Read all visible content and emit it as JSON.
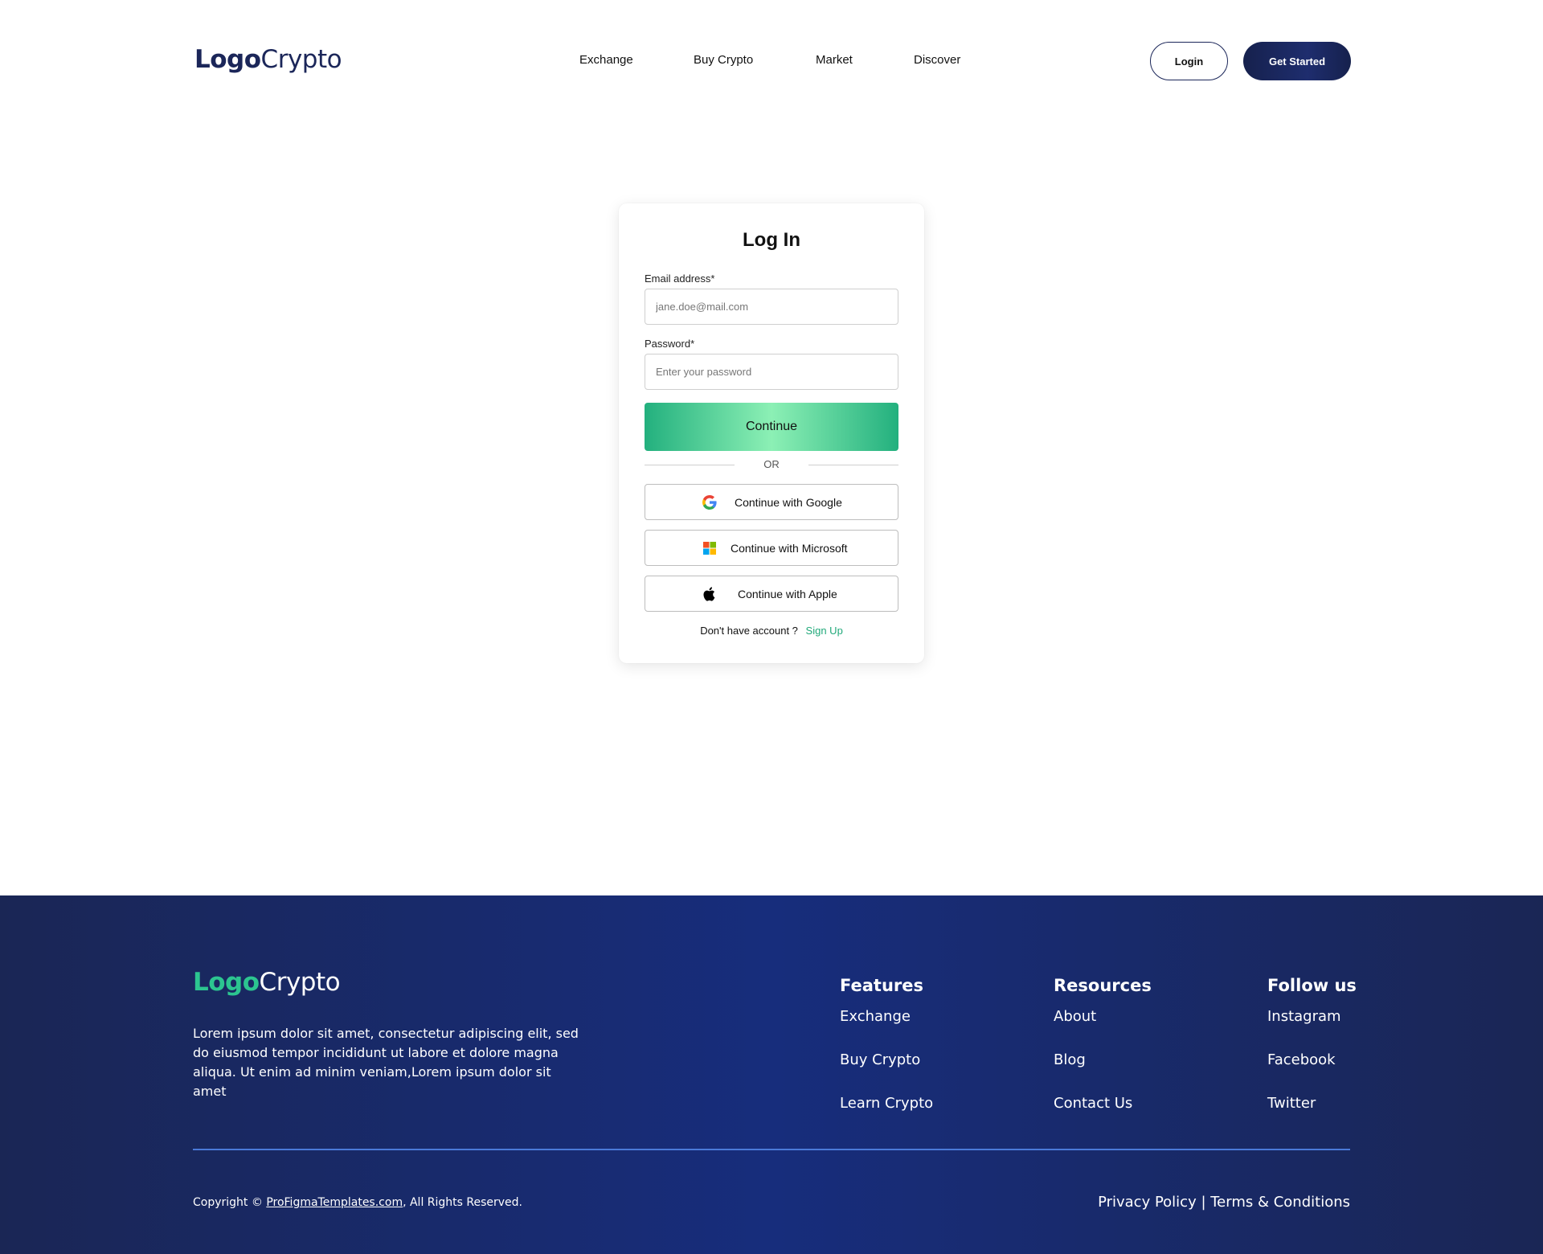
{
  "header": {
    "logo": {
      "part_a": "Logo",
      "part_b": "Crypto"
    },
    "nav": [
      "Exchange",
      "Buy Crypto",
      "Market",
      "Discover"
    ],
    "login_label": "Login",
    "get_started_label": "Get Started",
    "brand_color": "#1b2659"
  },
  "login_card": {
    "title": "Log In",
    "email_label": "Email address*",
    "email_placeholder": "jane.doe@mail.com",
    "password_label": "Password*",
    "password_placeholder": "Enter your password",
    "continue_label": "Continue",
    "or_label": "OR",
    "sso": [
      {
        "label": "Continue with Google",
        "icon": "google-icon"
      },
      {
        "label": "Continue with Microsoft",
        "icon": "microsoft-icon"
      },
      {
        "label": "Continue with Apple",
        "icon": "apple-icon"
      }
    ],
    "no_account_text": "Don't have account ?",
    "signup_label": "Sign Up",
    "accent_color": "#21a97a"
  },
  "footer": {
    "logo": {
      "part_a": "Logo",
      "part_b": "Crypto"
    },
    "description": "Lorem ipsum dolor sit amet, consectetur adipiscing elit, sed do eiusmod tempor incididunt ut labore et dolore magna aliqua. Ut enim ad minim veniam,Lorem ipsum dolor sit amet",
    "columns": [
      {
        "title": "Features",
        "links": [
          "Exchange",
          "Buy Crypto",
          "Learn Crypto"
        ]
      },
      {
        "title": "Resources",
        "links": [
          "About",
          "Blog",
          "Contact Us"
        ]
      },
      {
        "title": "Follow us",
        "links": [
          "Instagram",
          "Facebook",
          "Twitter"
        ]
      }
    ],
    "copyright_prefix": "Copyright © ",
    "copyright_site": "ProFigmaTemplates.com",
    "copyright_suffix": ", All Rights Reserved.",
    "legal": "Privacy Policy | Terms & Conditions",
    "background_color": "#172d7c",
    "logo_accent_color": "#2cc590"
  }
}
